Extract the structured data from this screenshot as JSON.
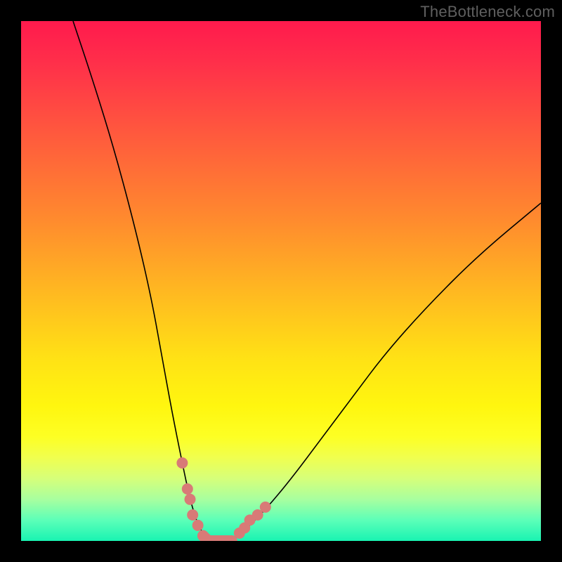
{
  "watermark": "TheBottleneck.com",
  "colors": {
    "background": "#000000",
    "marker": "#d87a77",
    "curve": "#000000",
    "gradient_top": "#ff1a4d",
    "gradient_bottom": "#19f3b2"
  },
  "chart_data": {
    "type": "line",
    "title": "",
    "xlabel": "",
    "ylabel": "",
    "xlim": [
      0,
      100
    ],
    "ylim": [
      0,
      100
    ],
    "series": [
      {
        "name": "bottleneck-curve",
        "x": [
          10,
          14,
          18,
          22,
          25,
          27,
          29,
          31,
          32.5,
          34,
          36,
          38,
          40.5,
          43,
          47,
          52,
          58,
          64,
          70,
          78,
          88,
          100
        ],
        "y": [
          100,
          88,
          75,
          60,
          47,
          36,
          25,
          15,
          8,
          3,
          0,
          0,
          0,
          2,
          6,
          12,
          20,
          28,
          36,
          45,
          55,
          65
        ]
      }
    ],
    "markers": {
      "name": "highlighted-points",
      "points": [
        {
          "x": 31.0,
          "y": 15.0
        },
        {
          "x": 32.0,
          "y": 10.0
        },
        {
          "x": 32.5,
          "y": 8.0
        },
        {
          "x": 33.0,
          "y": 5.0
        },
        {
          "x": 34.0,
          "y": 3.0
        },
        {
          "x": 35.0,
          "y": 1.0
        },
        {
          "x": 36.0,
          "y": 0.0
        },
        {
          "x": 37.0,
          "y": 0.0
        },
        {
          "x": 38.0,
          "y": 0.0
        },
        {
          "x": 39.0,
          "y": 0.0
        },
        {
          "x": 40.5,
          "y": 0.0
        },
        {
          "x": 42.0,
          "y": 1.5
        },
        {
          "x": 43.0,
          "y": 2.5
        },
        {
          "x": 44.0,
          "y": 4.0
        },
        {
          "x": 45.5,
          "y": 5.0
        },
        {
          "x": 47.0,
          "y": 6.5
        }
      ]
    }
  }
}
